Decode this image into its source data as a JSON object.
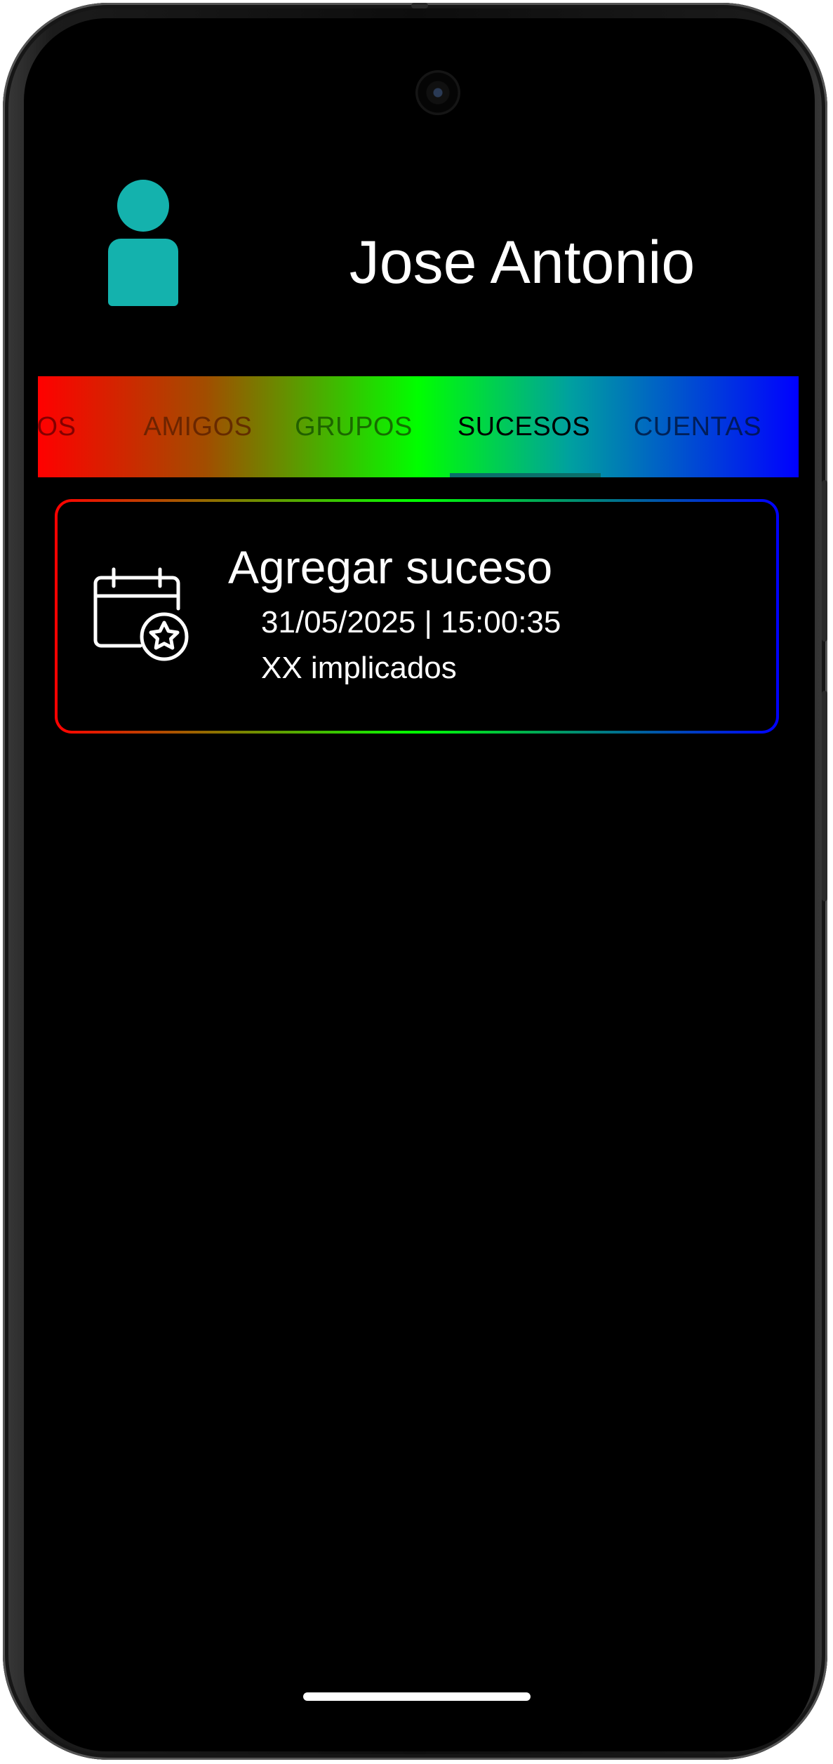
{
  "profile": {
    "name": "Jose Antonio",
    "avatar_icon": "person-icon",
    "accent_color": "#14b2ad"
  },
  "tabs": [
    {
      "label": "TOS"
    },
    {
      "label": "AMIGOS"
    },
    {
      "label": "GRUPOS"
    },
    {
      "label": "SUCESOS",
      "selected": true
    },
    {
      "label": "CUENTAS"
    }
  ],
  "event_card": {
    "icon": "calendar-star-icon",
    "title": "Agregar suceso",
    "datetime": "31/05/2025 | 15:00:35",
    "involved": "XX implicados"
  }
}
